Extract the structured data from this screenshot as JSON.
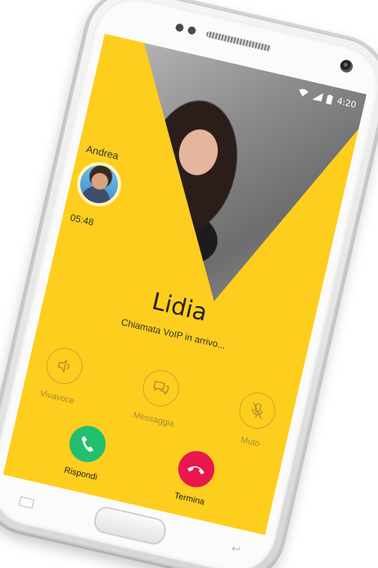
{
  "status_bar": {
    "time": "4:20",
    "icons": [
      "wifi-icon",
      "signal-icon",
      "battery-icon"
    ]
  },
  "caller": {
    "name": "Andrea",
    "duration": "05:48"
  },
  "incoming": {
    "name": "Lidia",
    "subtitle": "Chiamata VoIP in arrivo..."
  },
  "actions": [
    {
      "label": "Vivavoce",
      "icon": "speaker-icon"
    },
    {
      "label": "Messaggia",
      "icon": "message-icon"
    },
    {
      "label": "Muto",
      "icon": "mute-microphone-icon"
    }
  ],
  "call_controls": {
    "answer_label": "Rispondi",
    "hangup_label": "Termina"
  },
  "colors": {
    "screen_background": "#fece1e",
    "answer": "#22bf6e",
    "hangup": "#e8184f"
  }
}
